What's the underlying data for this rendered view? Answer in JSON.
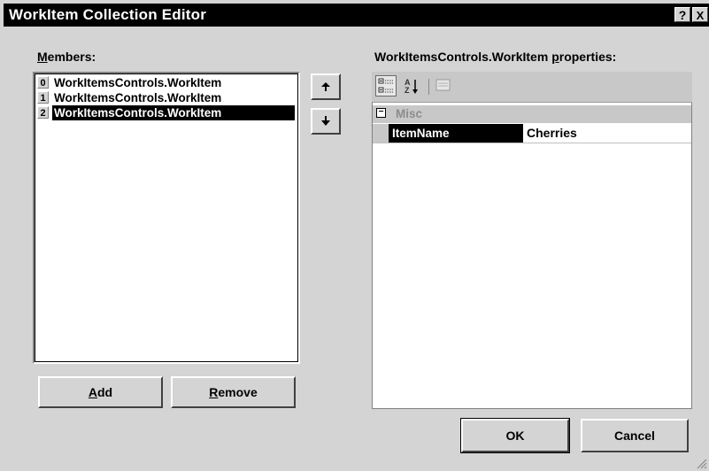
{
  "window": {
    "title": "WorkItem Collection Editor",
    "help_button": "?",
    "close_button": "X"
  },
  "members": {
    "label_mnemonic": "M",
    "label_rest": "embers:",
    "items": [
      {
        "index": "0",
        "text": "WorkItemsControls.WorkItem"
      },
      {
        "index": "1",
        "text": "WorkItemsControls.WorkItem"
      },
      {
        "index": "2",
        "text": "WorkItemsControls.WorkItem"
      }
    ],
    "selected_index": 2,
    "move_up_icon": "arrow-up-icon",
    "move_down_icon": "arrow-down-icon"
  },
  "buttons": {
    "add_mnemonic": "A",
    "add_rest": "dd",
    "remove_mnemonic": "R",
    "remove_rest": "emove",
    "ok": "OK",
    "cancel": "Cancel"
  },
  "properties": {
    "heading_prefix": "WorkItemsControls.WorkItem ",
    "heading_mnemonic": "p",
    "heading_rest": "roperties:",
    "toolbar_icons": [
      "categorized-icon",
      "alphabetical-icon",
      "property-pages-icon"
    ],
    "category": "Misc",
    "category_toggle": "−",
    "rows": [
      {
        "name": "ItemName",
        "value": "Cherries"
      }
    ]
  },
  "colors": {
    "title_bar": "#000000",
    "dialog_face": "#d4d4d4",
    "selection": "#000000"
  }
}
